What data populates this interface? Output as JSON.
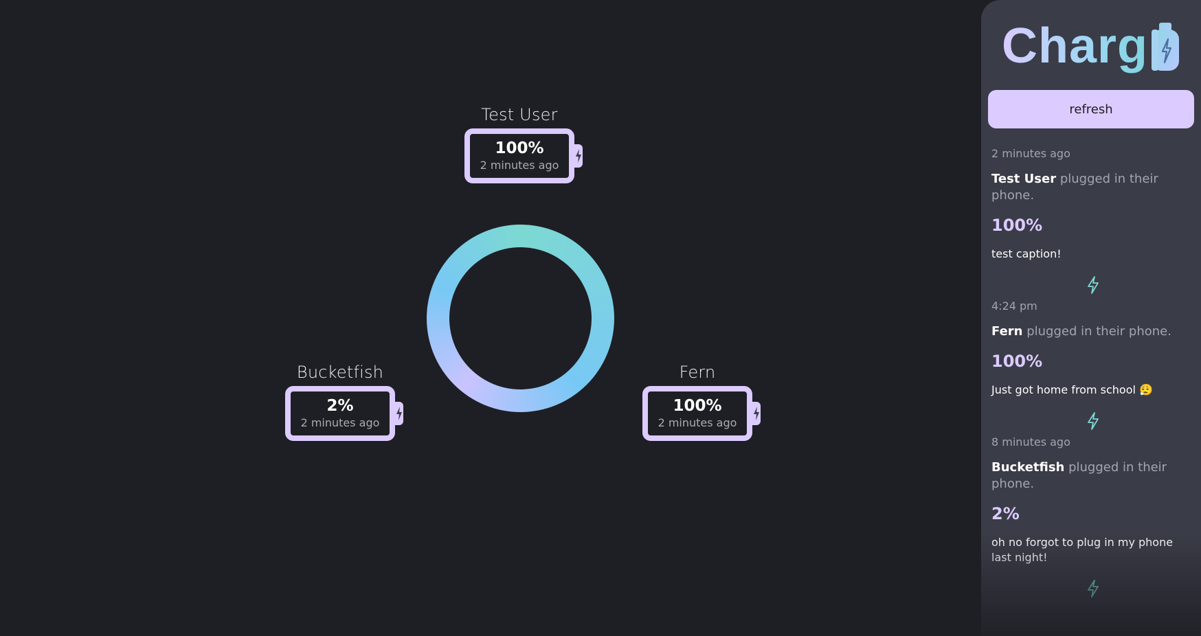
{
  "app": {
    "logo_text": "Charg",
    "brand_colors": {
      "lavender": "#dccbff",
      "cyan": "#7cd9d2",
      "sky": "#78c8f5",
      "background": "#1e1f24",
      "panel": "#3a3c47"
    }
  },
  "ring": {
    "icon": "charge-ring"
  },
  "users": [
    {
      "name": "Test User",
      "percent": "100%",
      "time": "2 minutes ago",
      "icon": "battery-charging-icon"
    },
    {
      "name": "Bucketfish",
      "percent": "2%",
      "time": "2 minutes ago",
      "icon": "battery-charging-icon"
    },
    {
      "name": "Fern",
      "percent": "100%",
      "time": "2 minutes ago",
      "icon": "battery-charging-icon"
    }
  ],
  "sidebar": {
    "refresh_label": "refresh",
    "feed": [
      {
        "time": "2 minutes ago",
        "name": "Test User",
        "action": " plugged in their phone.",
        "percent": "100%",
        "caption": "test caption!"
      },
      {
        "time": "4:24 pm",
        "name": "Fern",
        "action": " plugged in their phone.",
        "percent": "100%",
        "caption": "Just got home from school 😮‍💨"
      },
      {
        "time": "8 minutes ago",
        "name": "Bucketfish",
        "action": " plugged in their phone.",
        "percent": "2%",
        "caption": "oh no forgot to plug in my phone last night!"
      }
    ],
    "separator_icon": "lightning-bolt-icon"
  }
}
